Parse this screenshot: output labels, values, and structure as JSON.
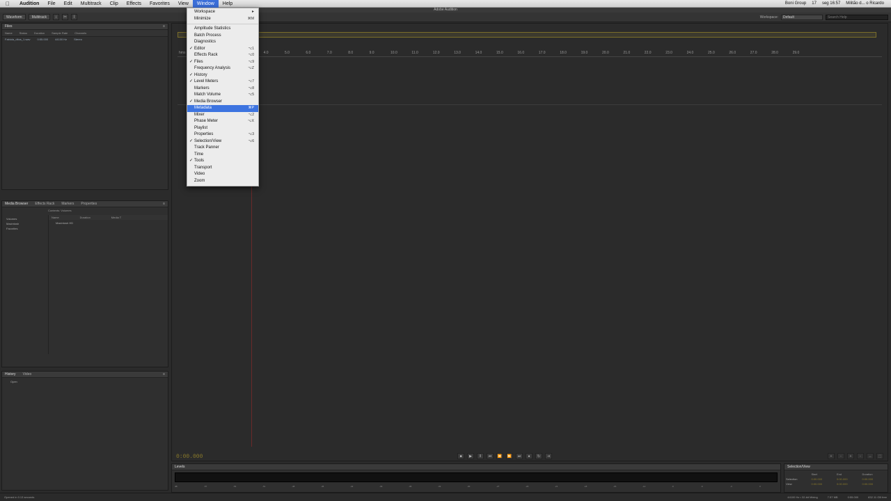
{
  "menubar": {
    "app": "Audition",
    "items": [
      "File",
      "Edit",
      "Multitrack",
      "Clip",
      "Effects",
      "Favorites",
      "View",
      "Window",
      "Help"
    ],
    "active": "Window",
    "right": [
      "Boni Group",
      "17",
      "seg 16:57",
      "Militão d... o Ricardo"
    ]
  },
  "titlebar": {
    "title": "Adobe Audition"
  },
  "toolbar": {
    "waveform": "Waveform",
    "multitrack": "Multitrack",
    "workspace_label": "Workspace:",
    "workspace_value": "Default",
    "search_placeholder": "Search Help"
  },
  "files_panel": {
    "tab": "Files",
    "columns": [
      "Name",
      "Status",
      "Duration",
      "Sample Rate",
      "Channels"
    ],
    "rows": [
      {
        "name": "Fabiola_ditos_1.wav",
        "duration": "0:55.000",
        "rate": "44100 Hz",
        "channels": "Stereo"
      }
    ]
  },
  "media_panel": {
    "tabs": [
      "Media Browser",
      "Effects Rack",
      "Markers",
      "Properties"
    ],
    "contents_label": "Contents:",
    "contents_value": "Volumes",
    "tree": [
      "Volumes",
      "Macintosh",
      "Favorites"
    ],
    "list_headers": [
      "Name",
      "Duration",
      "Media T"
    ],
    "list_items": [
      "Macintosh HD"
    ]
  },
  "history_panel": {
    "tabs": [
      "History",
      "Video"
    ],
    "items": [
      "Open"
    ]
  },
  "editor": {
    "ruler": [
      "hms",
      "1.0",
      "2.0",
      "3.0",
      "4.0",
      "5.0",
      "6.0",
      "7.0",
      "8.0",
      "9.0",
      "10.0",
      "11.0",
      "12.0",
      "13.0",
      "14.0",
      "15.0",
      "16.0",
      "17.0",
      "18.0",
      "19.0",
      "20.0",
      "21.0",
      "22.0",
      "23.0",
      "24.0",
      "25.0",
      "26.0",
      "27.0",
      "28.0",
      "29.0"
    ],
    "time_display": "0:00.000"
  },
  "levels": {
    "tab": "Levels",
    "scale": [
      "dB",
      "-57",
      "-54",
      "-51",
      "-48",
      "-45",
      "-42",
      "-39",
      "-36",
      "-33",
      "-30",
      "-27",
      "-24",
      "-21",
      "-18",
      "-15",
      "-12",
      "-9",
      "-6",
      "-3",
      "0"
    ]
  },
  "selection_view": {
    "tab": "Selection/View",
    "headers": [
      "",
      "Start",
      "End",
      "Duration"
    ],
    "rows": [
      {
        "label": "Selection",
        "start": "0:00.000",
        "end": "0:00.000",
        "duration": "0:00.000"
      },
      {
        "label": "View",
        "start": "0:00.000",
        "end": "0:00.000",
        "duration": "0:00.000"
      }
    ]
  },
  "status": {
    "left": "Opened in 0.13 seconds",
    "right": [
      "44100 Hz • 32-bit Mixing",
      "7.57 MB",
      "0:55.000",
      "832.11 GB free"
    ]
  },
  "window_menu": {
    "items": [
      {
        "label": "Workspace",
        "check": "",
        "shortcut": "▸",
        "type": "sub"
      },
      {
        "label": "Minimize",
        "check": "",
        "shortcut": "⌘M"
      },
      {
        "type": "sep"
      },
      {
        "label": "Amplitude Statistics",
        "check": "",
        "shortcut": ""
      },
      {
        "label": "Batch Process",
        "check": "",
        "shortcut": ""
      },
      {
        "label": "Diagnostics",
        "check": "",
        "shortcut": ""
      },
      {
        "label": "Editor",
        "check": "✓",
        "shortcut": "⌥1"
      },
      {
        "label": "Effects Rack",
        "check": "",
        "shortcut": "⌥0"
      },
      {
        "label": "Files",
        "check": "✓",
        "shortcut": "⌥9"
      },
      {
        "label": "Frequency Analysis",
        "check": "",
        "shortcut": "⌥Z"
      },
      {
        "label": "History",
        "check": "✓",
        "shortcut": ""
      },
      {
        "label": "Level Meters",
        "check": "✓",
        "shortcut": "⌥7"
      },
      {
        "label": "Markers",
        "check": "",
        "shortcut": "⌥8"
      },
      {
        "label": "Match Volume",
        "check": "",
        "shortcut": "⌥5"
      },
      {
        "label": "Media Browser",
        "check": "✓",
        "shortcut": ""
      },
      {
        "label": "Metadata",
        "check": "",
        "shortcut": "⌘P",
        "highlight": true
      },
      {
        "label": "Mixer",
        "check": "",
        "shortcut": "⌥2"
      },
      {
        "label": "Phase Meter",
        "check": "",
        "shortcut": "⌥X"
      },
      {
        "label": "Playlist",
        "check": "",
        "shortcut": ""
      },
      {
        "label": "Properties",
        "check": "",
        "shortcut": "⌥3"
      },
      {
        "label": "Selection/View",
        "check": "✓",
        "shortcut": "⌥6"
      },
      {
        "label": "Track Panner",
        "check": "",
        "shortcut": ""
      },
      {
        "label": "Time",
        "check": "",
        "shortcut": ""
      },
      {
        "label": "Tools",
        "check": "✓",
        "shortcut": ""
      },
      {
        "label": "Transport",
        "check": "",
        "shortcut": ""
      },
      {
        "label": "Video",
        "check": "",
        "shortcut": ""
      },
      {
        "label": "Zoom",
        "check": "",
        "shortcut": ""
      }
    ]
  }
}
